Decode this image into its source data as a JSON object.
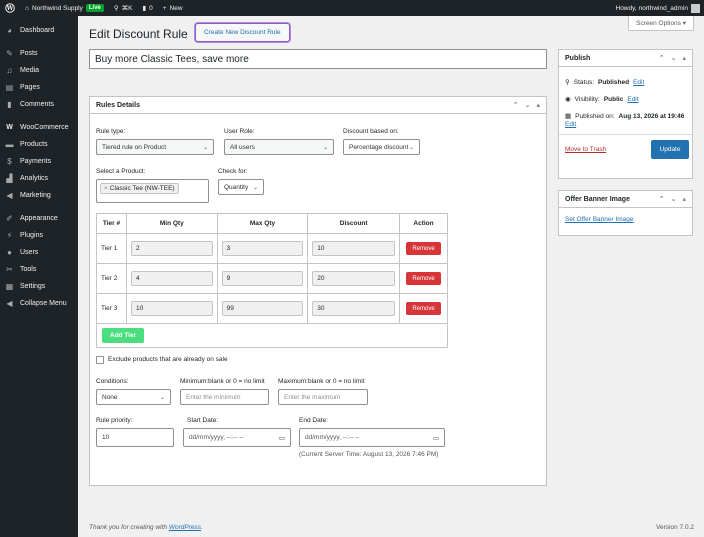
{
  "adminbar": {
    "site_name": "Northwind Supply",
    "live_badge": "Live",
    "shortcut": "⌘K",
    "comments_count": "0",
    "new_label": "New",
    "howdy": "Howdy, northwind_admin"
  },
  "sidebar": {
    "items": [
      {
        "label": "Dashboard",
        "icon": "dashboard-icon"
      },
      {
        "label": "Posts",
        "icon": "pin-icon"
      },
      {
        "label": "Media",
        "icon": "media-icon"
      },
      {
        "label": "Pages",
        "icon": "pages-icon"
      },
      {
        "label": "Comments",
        "icon": "comment-icon"
      },
      {
        "label": "WooCommerce",
        "icon": "woo-icon"
      },
      {
        "label": "Products",
        "icon": "products-icon"
      },
      {
        "label": "Payments",
        "icon": "payments-icon"
      },
      {
        "label": "Analytics",
        "icon": "analytics-icon"
      },
      {
        "label": "Marketing",
        "icon": "megaphone-icon"
      },
      {
        "label": "Appearance",
        "icon": "brush-icon"
      },
      {
        "label": "Plugins",
        "icon": "plugin-icon"
      },
      {
        "label": "Users",
        "icon": "users-icon"
      },
      {
        "label": "Tools",
        "icon": "wrench-icon"
      },
      {
        "label": "Settings",
        "icon": "settings-icon"
      },
      {
        "label": "Collapse Menu",
        "icon": "collapse-icon"
      }
    ]
  },
  "screen_options": "Screen Options ▾",
  "page_title": "Edit Discount Rule",
  "add_new_button": "Create New Discount Rule",
  "rule_title": "Buy more Classic Tees, save more",
  "rules_box": {
    "title": "Rules Details",
    "rule_type_label": "Rule type:",
    "rule_type_value": "Tiered rule on Product",
    "user_role_label": "User Role:",
    "user_role_value": "All users",
    "discount_based_label": "Discount based on:",
    "discount_based_value": "Percentage discount",
    "select_product_label": "Select a Product:",
    "product_tag": "Classic Tee (NW-TEE)",
    "check_for_label": "Check for:",
    "check_for_value": "Quantity",
    "table_headers": [
      "Tier #",
      "Min Qty",
      "Max Qty",
      "Discount",
      "Action"
    ],
    "tiers": [
      {
        "name": "Tier 1",
        "min": "2",
        "max": "3",
        "discount": "10",
        "action": "Remove"
      },
      {
        "name": "Tier 2",
        "min": "4",
        "max": "9",
        "discount": "20",
        "action": "Remove"
      },
      {
        "name": "Tier 3",
        "min": "10",
        "max": "99",
        "discount": "30",
        "action": "Remove"
      }
    ],
    "add_tier": "Add Tier",
    "exclude_label": "Exclude products that are already on sale",
    "conditions_label": "Conditions:",
    "conditions_value": "None",
    "minimum_label": "Minimum:blank or 0 = no limit",
    "minimum_placeholder": "Enter the minimum",
    "maximum_label": "Maximum:blank or 0 = no limit",
    "maximum_placeholder": "Enter the maximum",
    "priority_label": "Rule priority:",
    "priority_value": "10",
    "start_label": "Start Date:",
    "start_placeholder": "dd/mm/yyyy, --:-- --",
    "end_label": "End Date:",
    "end_placeholder": "dd/mm/yyyy, --:-- --",
    "server_time": "(Current Server Time: August 13, 2026 7:46 PM)"
  },
  "publish": {
    "title": "Publish",
    "status_label": "Status:",
    "status_value": "Published",
    "visibility_label": "Visibility:",
    "visibility_value": "Public",
    "published_label": "Published on:",
    "published_value": "Aug 13, 2026 at 19:46",
    "edit": "Edit",
    "trash": "Move to Trash",
    "update": "Update"
  },
  "offer_banner": {
    "title": "Offer Banner Image",
    "link": "Set Offer Banner Image"
  },
  "footer": {
    "thanks_prefix": "Thank you for creating with ",
    "thanks_link": "WordPress",
    "thanks_suffix": ".",
    "version": "Version 7.0.2"
  },
  "colors": {
    "admin_dark": "#1d2327",
    "primary_blue": "#2271b1",
    "remove_red": "#d63638",
    "add_green": "#4ade80",
    "live_green": "#00a32a"
  }
}
